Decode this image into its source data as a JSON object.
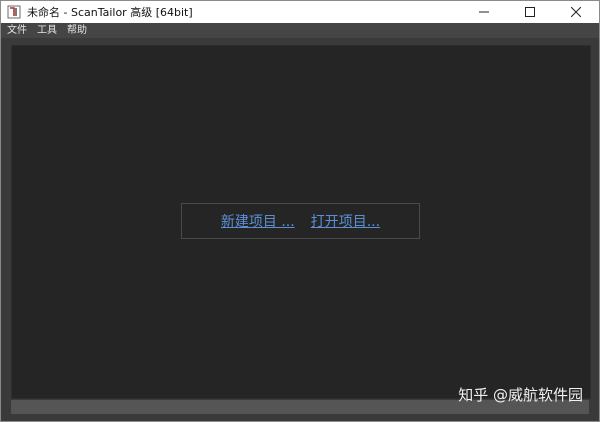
{
  "window": {
    "title": "未命名 - ScanTailor 高级 [64bit]",
    "icon": "scantailor-app-icon"
  },
  "caption_buttons": {
    "minimize": "minimize-icon",
    "maximize": "maximize-icon",
    "close": "close-icon"
  },
  "menu": {
    "items": [
      {
        "label": "文件"
      },
      {
        "label": "工具"
      },
      {
        "label": "帮助"
      }
    ]
  },
  "start": {
    "new_project": "新建项目 ...",
    "open_project": "打开项目..."
  },
  "watermark": {
    "text": "知乎 @威航软件园"
  },
  "colors": {
    "link": "#5a8fd6",
    "panel_bg": "#252525",
    "menubar_bg": "#454545"
  }
}
